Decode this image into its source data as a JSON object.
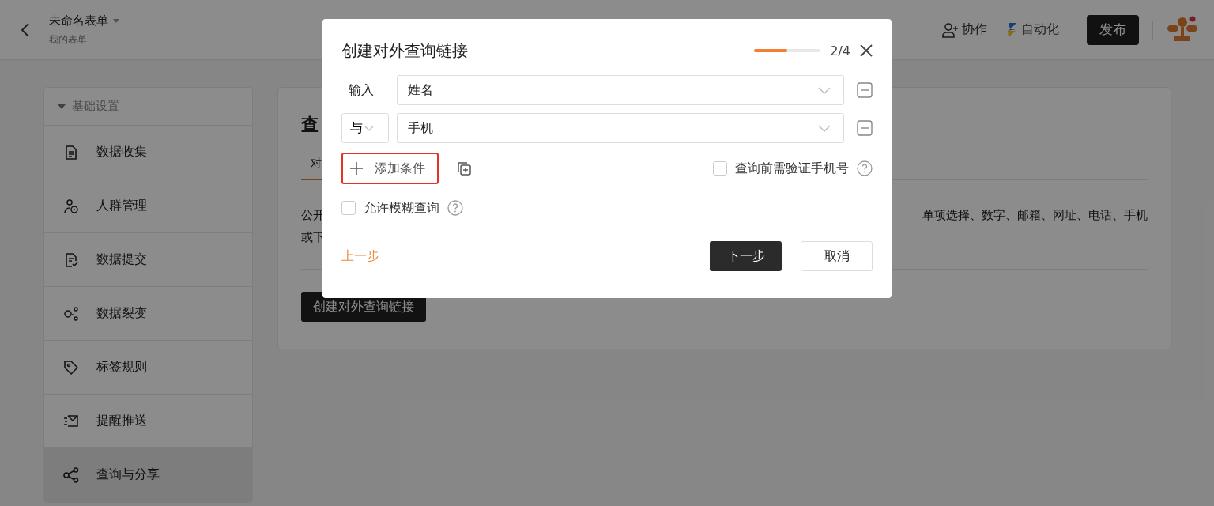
{
  "header": {
    "title": "未命名表单",
    "subtitle": "我的表单",
    "actions": [
      {
        "kind": "collab",
        "label": "协作"
      },
      {
        "kind": "auto",
        "label": "自动化"
      }
    ],
    "publish": "发布"
  },
  "sidebar": {
    "section": "基础设置",
    "items": [
      {
        "kind": "doc",
        "label": "数据收集",
        "selected": false
      },
      {
        "kind": "people",
        "label": "人群管理",
        "selected": false
      },
      {
        "kind": "doc-check",
        "label": "数据提交",
        "selected": false
      },
      {
        "kind": "nodes",
        "label": "数据裂变",
        "selected": false
      },
      {
        "kind": "tag",
        "label": "标签规则",
        "selected": false
      },
      {
        "kind": "mail",
        "label": "提醒推送",
        "selected": false
      },
      {
        "kind": "share",
        "label": "查询与分享",
        "selected": true
      }
    ]
  },
  "main": {
    "title": "查",
    "tab": "对",
    "paragraph_left": [
      "公开",
      "或下"
    ],
    "paragraph_right": "单项选择、数字、邮箱、网址、电话、手机",
    "create_button": "创建对外查询链接"
  },
  "dialog": {
    "title": "创建对外查询链接",
    "progress": {
      "level": 0.5,
      "text": "2/4"
    },
    "conditions": [
      {
        "kind": "label",
        "prefix": "输入",
        "field": "姓名"
      },
      {
        "kind": "select",
        "prefix": "与",
        "field": "手机"
      }
    ],
    "add_button": {
      "label": "添加条件",
      "highlighted": true
    },
    "verify_phone": {
      "label": "查询前需验证手机号",
      "checked": false
    },
    "fuzzy": {
      "label": "允许模糊查询",
      "checked": false
    },
    "prev": "上一步",
    "next": "下一步",
    "cancel": "取消"
  }
}
